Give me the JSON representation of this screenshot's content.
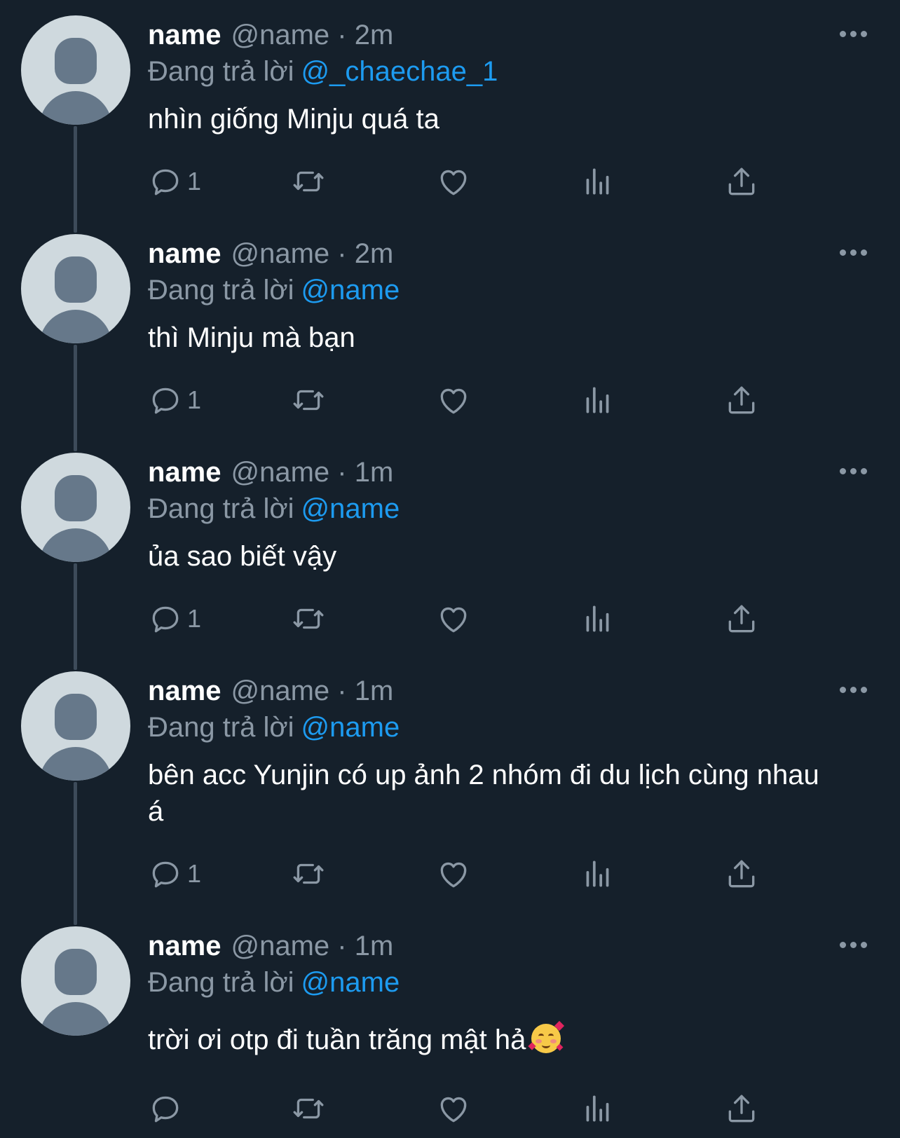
{
  "tweets": [
    {
      "name": "name",
      "handle": "@name · 2m",
      "replying_label": "Đang trả lời",
      "mention": "@_chaechae_1",
      "text": "nhìn giống Minju quá ta",
      "reply_count": "1"
    },
    {
      "name": "name",
      "handle": "@name · 2m",
      "replying_label": "Đang trả lời",
      "mention": "@name",
      "text": "thì Minju mà bạn",
      "reply_count": "1"
    },
    {
      "name": "name",
      "handle": "@name · 1m",
      "replying_label": "Đang trả lời",
      "mention": "@name",
      "text": "ủa sao biết vậy",
      "reply_count": "1"
    },
    {
      "name": "name",
      "handle": "@name · 1m",
      "replying_label": "Đang trả lời",
      "mention": "@name",
      "text": "bên acc Yunjin có up ảnh 2 nhóm đi du lịch cùng nhau á",
      "reply_count": "1"
    },
    {
      "name": "name",
      "handle": "@name · 1m",
      "replying_label": "Đang trả lời",
      "mention": "@name",
      "text": "trời ơi otp đi tuần trăng mật hả",
      "emoji": "smiling-face-with-hearts",
      "reply_count": ""
    }
  ],
  "icons": {
    "reply": "reply-icon",
    "retweet": "retweet-icon",
    "like": "like-icon",
    "views": "views-icon",
    "share": "share-icon",
    "more": "more-icon"
  },
  "colors": {
    "background": "#15202b",
    "text": "#ffffff",
    "secondary": "#8b98a5",
    "mention": "#1d9bf0",
    "thread_line": "#3d4b5a",
    "avatar_bg": "#cfd9de",
    "avatar_fg": "#66788a"
  }
}
